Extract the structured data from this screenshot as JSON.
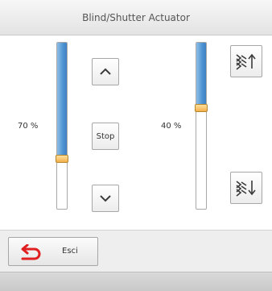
{
  "window": {
    "title": "Blind/Shutter Actuator"
  },
  "left_control": {
    "position_label": "70 %",
    "position": 0.7,
    "up_icon": "chevron-up-icon",
    "stop_label": "Stop",
    "down_icon": "chevron-down-icon"
  },
  "right_control": {
    "position_label": "40 %",
    "position": 0.4,
    "up_icon": "slats-up-icon",
    "down_icon": "slats-down-icon"
  },
  "footer": {
    "exit_label": "Esci",
    "exit_icon": "return-arrow-icon"
  },
  "colors": {
    "slider_fill": "#4f93d2",
    "slider_thumb": "#f2b04a",
    "exit_icon": "#e02020"
  }
}
